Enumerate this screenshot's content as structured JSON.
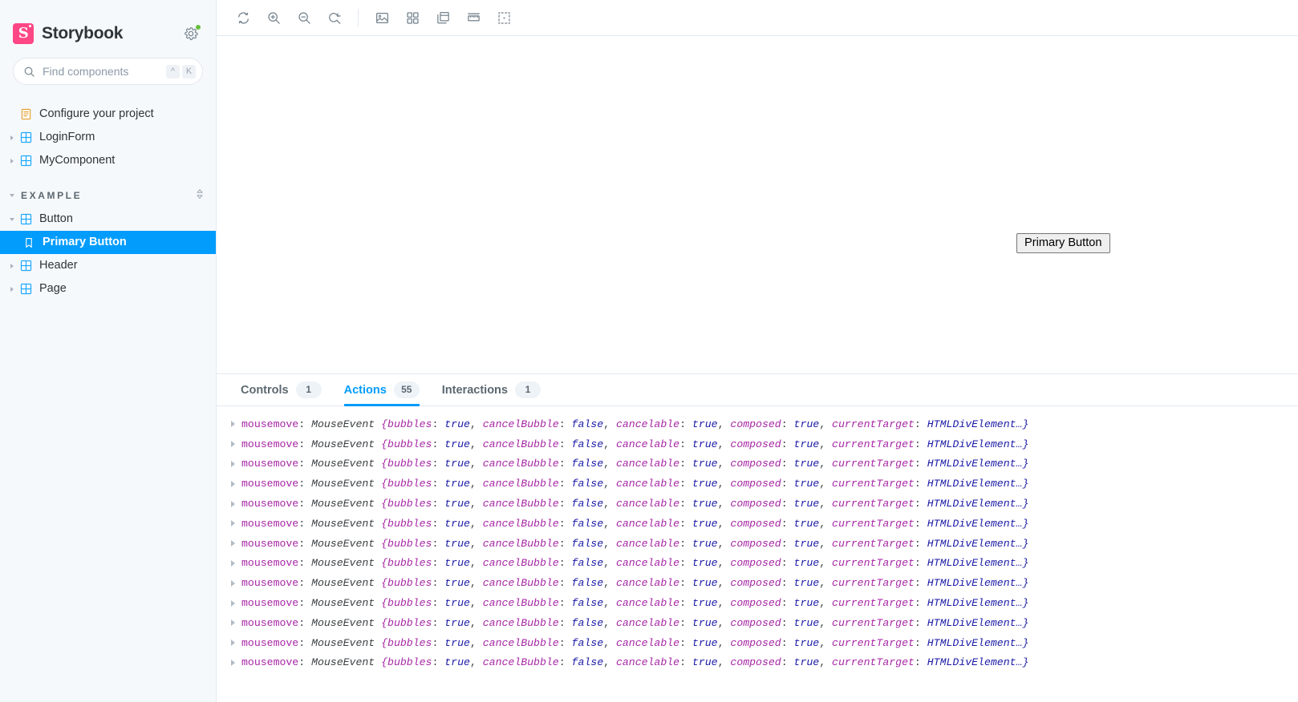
{
  "brand": {
    "logo_letter": "S",
    "title": "Storybook",
    "gear_icon": "gear-icon",
    "status_dot_color": "#66bf3c"
  },
  "search": {
    "placeholder": "Find components",
    "value": "",
    "icon": "search-icon",
    "shortcut_keys": [
      "^",
      "K"
    ]
  },
  "sidebar": {
    "items": [
      {
        "label": "Configure your project",
        "icon": "document-icon",
        "depth": 1,
        "twisty": "none",
        "selected": false
      },
      {
        "label": "LoginForm",
        "icon": "component-icon",
        "depth": 1,
        "twisty": "closed",
        "selected": false
      },
      {
        "label": "MyComponent",
        "icon": "component-icon",
        "depth": 1,
        "twisty": "closed",
        "selected": false
      }
    ],
    "group": {
      "label": "EXAMPLE",
      "twisty": "open",
      "expand_icon": "expand-collapse-icon"
    },
    "group_items": [
      {
        "label": "Button",
        "icon": "component-icon",
        "depth": 1,
        "twisty": "open",
        "selected": false
      },
      {
        "label": "Primary Button",
        "icon": "story-bookmark-icon",
        "depth": 2,
        "twisty": "none",
        "selected": true
      },
      {
        "label": "Header",
        "icon": "component-icon",
        "depth": 1,
        "twisty": "closed",
        "selected": false
      },
      {
        "label": "Page",
        "icon": "component-icon",
        "depth": 1,
        "twisty": "closed",
        "selected": false
      }
    ]
  },
  "toolbar": {
    "groups": [
      [
        {
          "name": "remount-button",
          "icon": "refresh-icon",
          "title": "Remount component"
        },
        {
          "name": "zoom-in-button",
          "icon": "zoom-in-icon",
          "title": "Zoom in"
        },
        {
          "name": "zoom-out-button",
          "icon": "zoom-out-icon",
          "title": "Zoom out"
        },
        {
          "name": "zoom-reset-button",
          "icon": "zoom-reset-icon",
          "title": "Reset zoom"
        }
      ],
      [
        {
          "name": "backgrounds-button",
          "icon": "photo-icon",
          "title": "Change background"
        },
        {
          "name": "grid-button",
          "icon": "grid-icon",
          "title": "Apply grid"
        },
        {
          "name": "viewport-button",
          "icon": "viewport-icon",
          "title": "Change viewport"
        },
        {
          "name": "measure-button",
          "icon": "ruler-icon",
          "title": "Enable measure"
        },
        {
          "name": "outline-button",
          "icon": "outline-icon",
          "title": "Apply outlines"
        }
      ]
    ]
  },
  "preview": {
    "button_label": "Primary Button"
  },
  "panel": {
    "tabs": [
      {
        "label": "Controls",
        "badge": "1",
        "active": false
      },
      {
        "label": "Actions",
        "badge": "55",
        "active": true
      },
      {
        "label": "Interactions",
        "badge": "1",
        "active": false
      }
    ],
    "accent_color": "#029cfd",
    "log_row_template": {
      "name": "mousemove",
      "class": "MouseEvent",
      "pairs": [
        {
          "key": "{bubbles",
          "value": "true"
        },
        {
          "key": "cancelBubble",
          "value": "false"
        },
        {
          "key": "cancelable",
          "value": "true"
        },
        {
          "key": "composed",
          "value": "true"
        },
        {
          "key": "currentTarget",
          "value": "HTMLDivElement…}"
        }
      ]
    },
    "log_row_count": 13
  }
}
